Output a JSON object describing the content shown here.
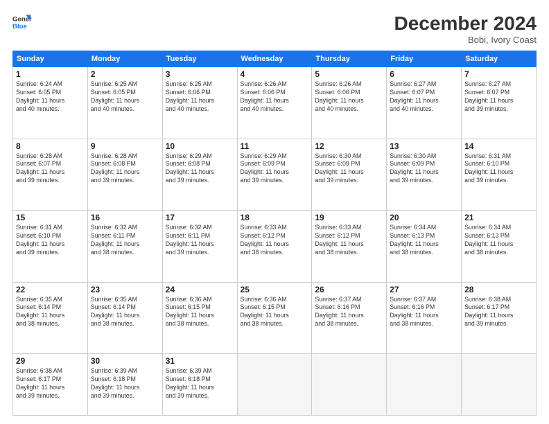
{
  "logo": {
    "line1": "General",
    "line2": "Blue"
  },
  "title": "December 2024",
  "subtitle": "Bobi, Ivory Coast",
  "weekdays": [
    "Sunday",
    "Monday",
    "Tuesday",
    "Wednesday",
    "Thursday",
    "Friday",
    "Saturday"
  ],
  "weeks": [
    [
      {
        "day": "1",
        "info": "Sunrise: 6:24 AM\nSunset: 6:05 PM\nDaylight: 11 hours\nand 40 minutes."
      },
      {
        "day": "2",
        "info": "Sunrise: 6:25 AM\nSunset: 6:05 PM\nDaylight: 11 hours\nand 40 minutes."
      },
      {
        "day": "3",
        "info": "Sunrise: 6:25 AM\nSunset: 6:06 PM\nDaylight: 11 hours\nand 40 minutes."
      },
      {
        "day": "4",
        "info": "Sunrise: 6:26 AM\nSunset: 6:06 PM\nDaylight: 11 hours\nand 40 minutes."
      },
      {
        "day": "5",
        "info": "Sunrise: 6:26 AM\nSunset: 6:06 PM\nDaylight: 11 hours\nand 40 minutes."
      },
      {
        "day": "6",
        "info": "Sunrise: 6:27 AM\nSunset: 6:07 PM\nDaylight: 11 hours\nand 40 minutes."
      },
      {
        "day": "7",
        "info": "Sunrise: 6:27 AM\nSunset: 6:07 PM\nDaylight: 11 hours\nand 39 minutes."
      }
    ],
    [
      {
        "day": "8",
        "info": "Sunrise: 6:28 AM\nSunset: 6:07 PM\nDaylight: 11 hours\nand 39 minutes."
      },
      {
        "day": "9",
        "info": "Sunrise: 6:28 AM\nSunset: 6:08 PM\nDaylight: 11 hours\nand 39 minutes."
      },
      {
        "day": "10",
        "info": "Sunrise: 6:29 AM\nSunset: 6:08 PM\nDaylight: 11 hours\nand 39 minutes."
      },
      {
        "day": "11",
        "info": "Sunrise: 6:29 AM\nSunset: 6:09 PM\nDaylight: 11 hours\nand 39 minutes."
      },
      {
        "day": "12",
        "info": "Sunrise: 6:30 AM\nSunset: 6:09 PM\nDaylight: 11 hours\nand 39 minutes."
      },
      {
        "day": "13",
        "info": "Sunrise: 6:30 AM\nSunset: 6:09 PM\nDaylight: 11 hours\nand 39 minutes."
      },
      {
        "day": "14",
        "info": "Sunrise: 6:31 AM\nSunset: 6:10 PM\nDaylight: 11 hours\nand 39 minutes."
      }
    ],
    [
      {
        "day": "15",
        "info": "Sunrise: 6:31 AM\nSunset: 6:10 PM\nDaylight: 11 hours\nand 39 minutes."
      },
      {
        "day": "16",
        "info": "Sunrise: 6:32 AM\nSunset: 6:11 PM\nDaylight: 11 hours\nand 38 minutes."
      },
      {
        "day": "17",
        "info": "Sunrise: 6:32 AM\nSunset: 6:11 PM\nDaylight: 11 hours\nand 39 minutes."
      },
      {
        "day": "18",
        "info": "Sunrise: 6:33 AM\nSunset: 6:12 PM\nDaylight: 11 hours\nand 38 minutes."
      },
      {
        "day": "19",
        "info": "Sunrise: 6:33 AM\nSunset: 6:12 PM\nDaylight: 11 hours\nand 38 minutes."
      },
      {
        "day": "20",
        "info": "Sunrise: 6:34 AM\nSunset: 6:13 PM\nDaylight: 11 hours\nand 38 minutes."
      },
      {
        "day": "21",
        "info": "Sunrise: 6:34 AM\nSunset: 6:13 PM\nDaylight: 11 hours\nand 38 minutes."
      }
    ],
    [
      {
        "day": "22",
        "info": "Sunrise: 6:35 AM\nSunset: 6:14 PM\nDaylight: 11 hours\nand 38 minutes."
      },
      {
        "day": "23",
        "info": "Sunrise: 6:35 AM\nSunset: 6:14 PM\nDaylight: 11 hours\nand 38 minutes."
      },
      {
        "day": "24",
        "info": "Sunrise: 6:36 AM\nSunset: 6:15 PM\nDaylight: 11 hours\nand 38 minutes."
      },
      {
        "day": "25",
        "info": "Sunrise: 6:36 AM\nSunset: 6:15 PM\nDaylight: 11 hours\nand 38 minutes."
      },
      {
        "day": "26",
        "info": "Sunrise: 6:37 AM\nSunset: 6:16 PM\nDaylight: 11 hours\nand 38 minutes."
      },
      {
        "day": "27",
        "info": "Sunrise: 6:37 AM\nSunset: 6:16 PM\nDaylight: 11 hours\nand 38 minutes."
      },
      {
        "day": "28",
        "info": "Sunrise: 6:38 AM\nSunset: 6:17 PM\nDaylight: 11 hours\nand 39 minutes."
      }
    ],
    [
      {
        "day": "29",
        "info": "Sunrise: 6:38 AM\nSunset: 6:17 PM\nDaylight: 11 hours\nand 39 minutes."
      },
      {
        "day": "30",
        "info": "Sunrise: 6:39 AM\nSunset: 6:18 PM\nDaylight: 11 hours\nand 39 minutes."
      },
      {
        "day": "31",
        "info": "Sunrise: 6:39 AM\nSunset: 6:18 PM\nDaylight: 11 hours\nand 39 minutes."
      },
      {
        "day": "",
        "info": ""
      },
      {
        "day": "",
        "info": ""
      },
      {
        "day": "",
        "info": ""
      },
      {
        "day": "",
        "info": ""
      }
    ]
  ]
}
